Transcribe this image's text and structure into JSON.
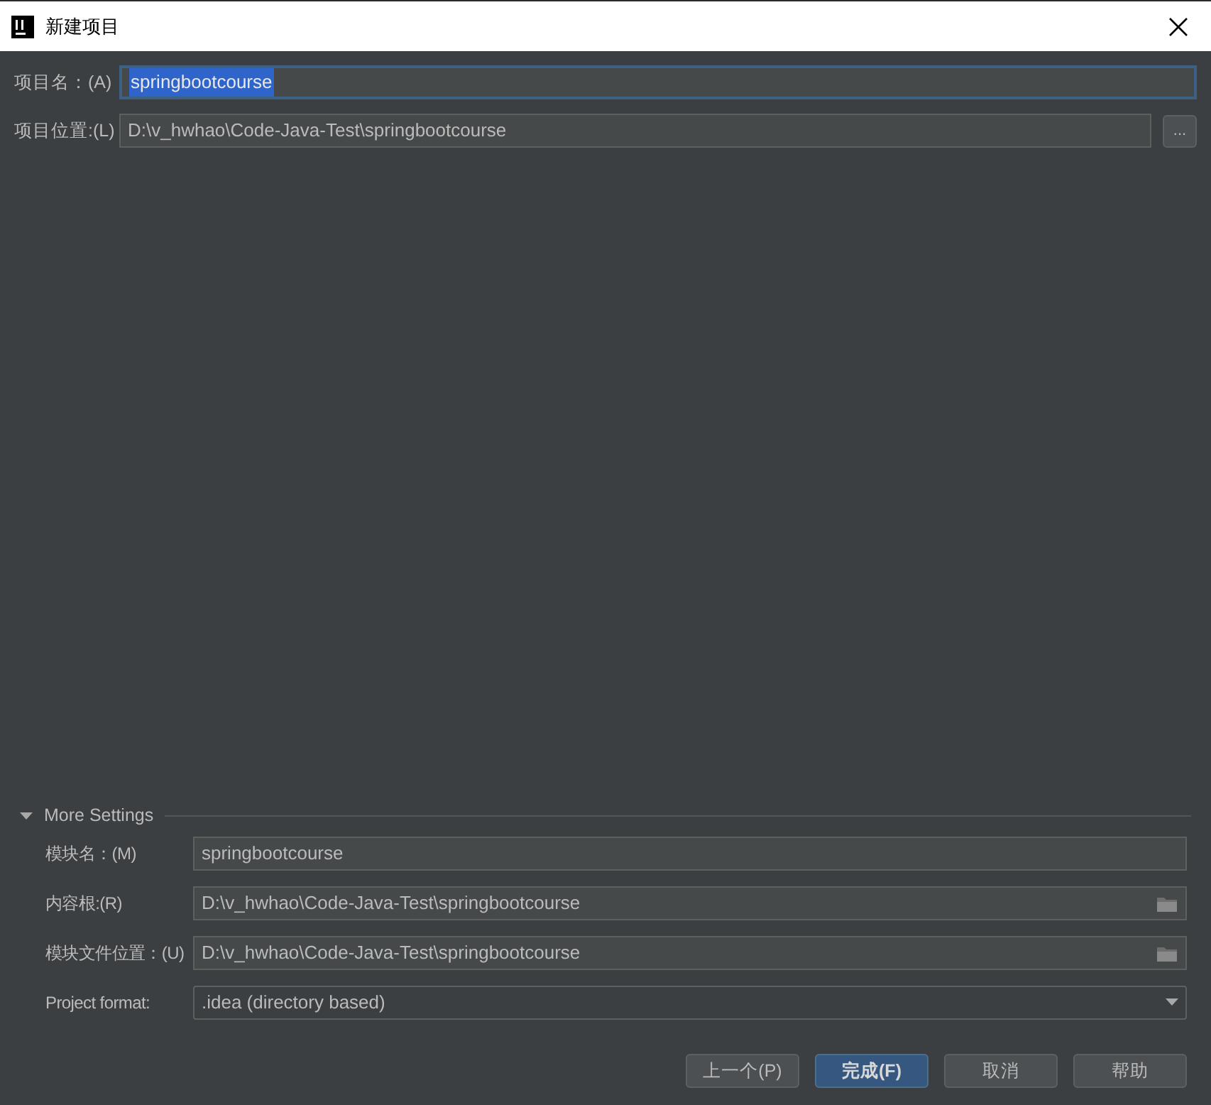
{
  "window": {
    "title": "新建项目"
  },
  "fields": [
    {
      "label": "项目名：(A)",
      "value": "springbootcourse",
      "focused": true
    },
    {
      "label": "项目位置:(L)",
      "value": "D:\\v_hwhao\\Code-Java-Test\\springbootcourse",
      "focused": false,
      "browse_button": "..."
    }
  ],
  "more_settings": {
    "title": "More Settings",
    "expanded": true,
    "fields": [
      {
        "kind": "text",
        "label": "模块名：(M)",
        "value": "springbootcourse"
      },
      {
        "kind": "path",
        "label": "内容根:(R)",
        "value": "D:\\v_hwhao\\Code-Java-Test\\springbootcourse"
      },
      {
        "kind": "path",
        "label": "模块文件位置：(U)",
        "value": "D:\\v_hwhao\\Code-Java-Test\\springbootcourse"
      },
      {
        "kind": "select",
        "label": "Project format:",
        "value": ".idea (directory based)"
      }
    ]
  },
  "buttons": [
    {
      "label": "上一个(P)",
      "primary": false
    },
    {
      "label": "完成(F)",
      "primary": true
    },
    {
      "label": "取消",
      "primary": false
    },
    {
      "label": "帮助",
      "primary": false
    }
  ]
}
